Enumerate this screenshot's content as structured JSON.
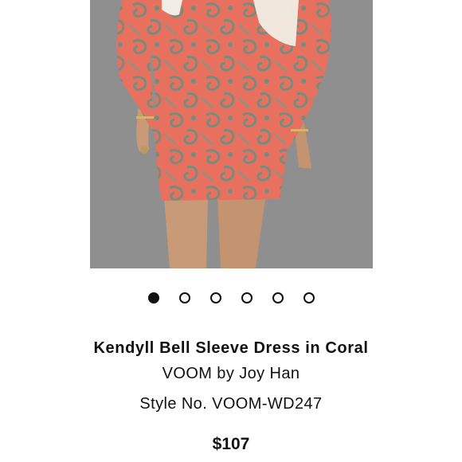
{
  "product": {
    "image_alt": "Model wearing coral paisley bell sleeve dress",
    "title": "Kendyll Bell Sleeve Dress in Coral",
    "brand": "VOOM by Joy Han",
    "style_number": "Style No. VOOM-WD247",
    "price": "$107"
  },
  "carousel": {
    "count": 6,
    "active_index": 0
  },
  "colors": {
    "dress": "#e8705e",
    "paisley": "#6f8f82",
    "backdrop": "#8f8f8f",
    "lace": "#f2ede4",
    "skin": "#c99a78"
  }
}
